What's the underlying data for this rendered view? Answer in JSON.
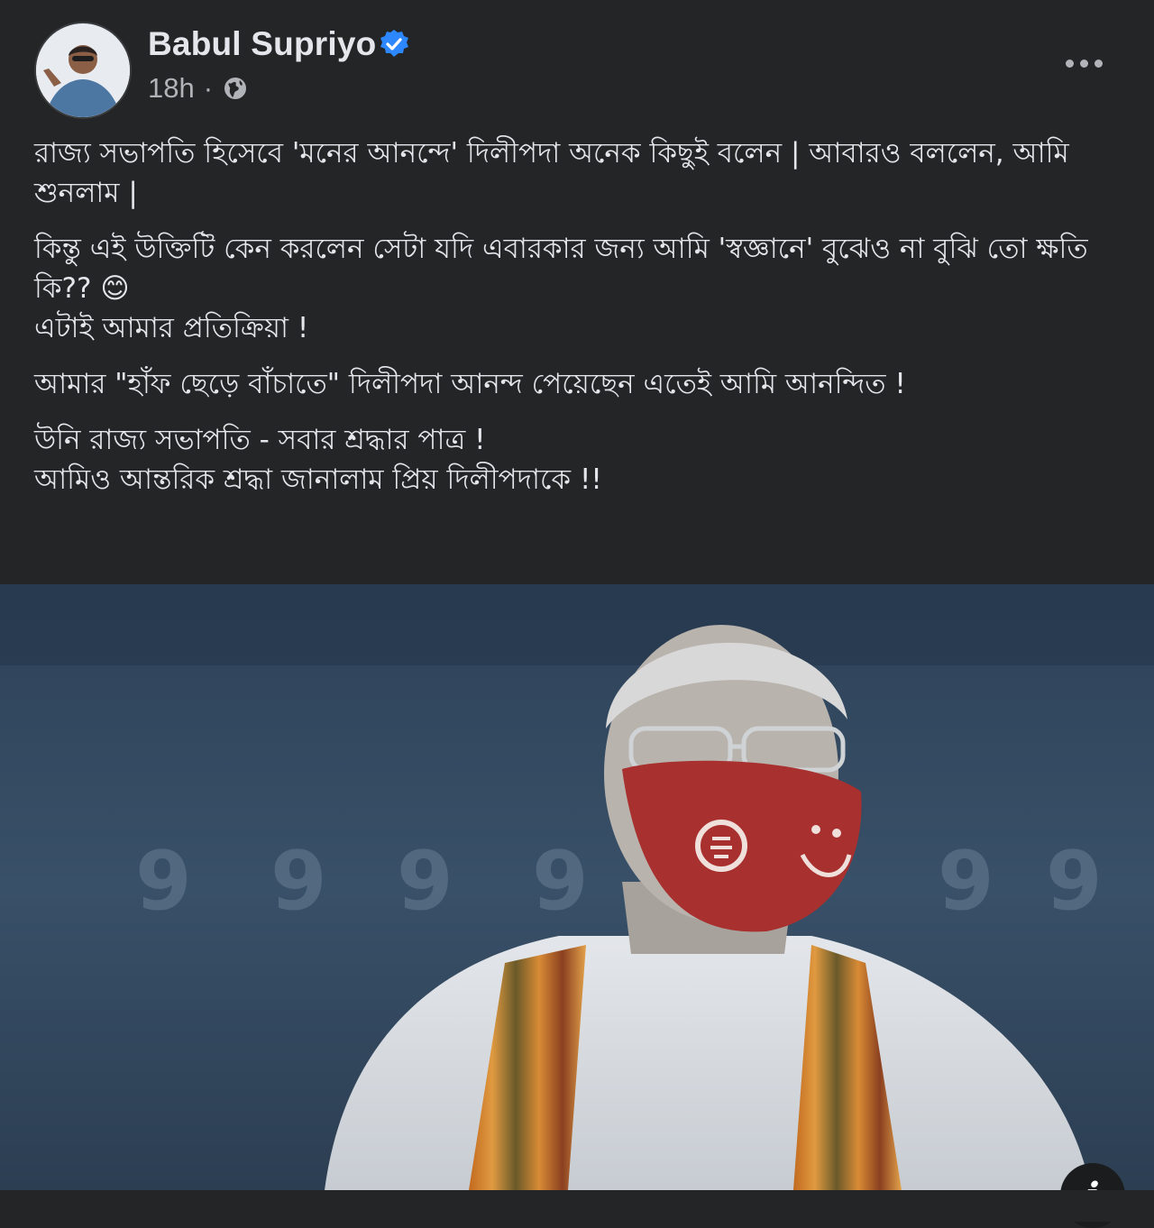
{
  "post": {
    "author": "Babul Supriyo",
    "time": "18h",
    "separator": "·",
    "privacy_icon": "globe-icon",
    "verified_icon": "verified-badge-icon",
    "more_icon": "more-options-icon",
    "paragraphs": [
      "রাজ্য সভাপতি হিসেবে 'মনের আনন্দে' দিলীপদা অনেক কিছুই বলেন | আবারও বললেন, আমি শুনলাম |",
      "কিন্তু এই উক্তিটি কেন করলেন সেটা যদি এবারকার জন্য আমি 'স্বজ্ঞানে' বুঝেও না বুঝি তো ক্ষতি কি?? 😊\nএটাই আমার প্রতিক্রিয়া !",
      "আমার \"হাঁফ ছেড়ে বাঁচাতে\" দিলীপদা আনন্দ পেয়েছেন এতেই আমি আনন্দিত !",
      "উনি রাজ্য সভাপতি - সবার শ্রদ্ধার পাত্র !\nআমিও আন্তরিক শ্রদ্ধা জানালাম প্রিয় দিলীপদাকে !!"
    ],
    "image": {
      "description_icon": "info-icon",
      "info_label": "i"
    }
  },
  "colors": {
    "background": "#242526",
    "text": "#e4e6eb",
    "secondary_text": "#b0b3b8",
    "verified": "#2d88ff"
  }
}
